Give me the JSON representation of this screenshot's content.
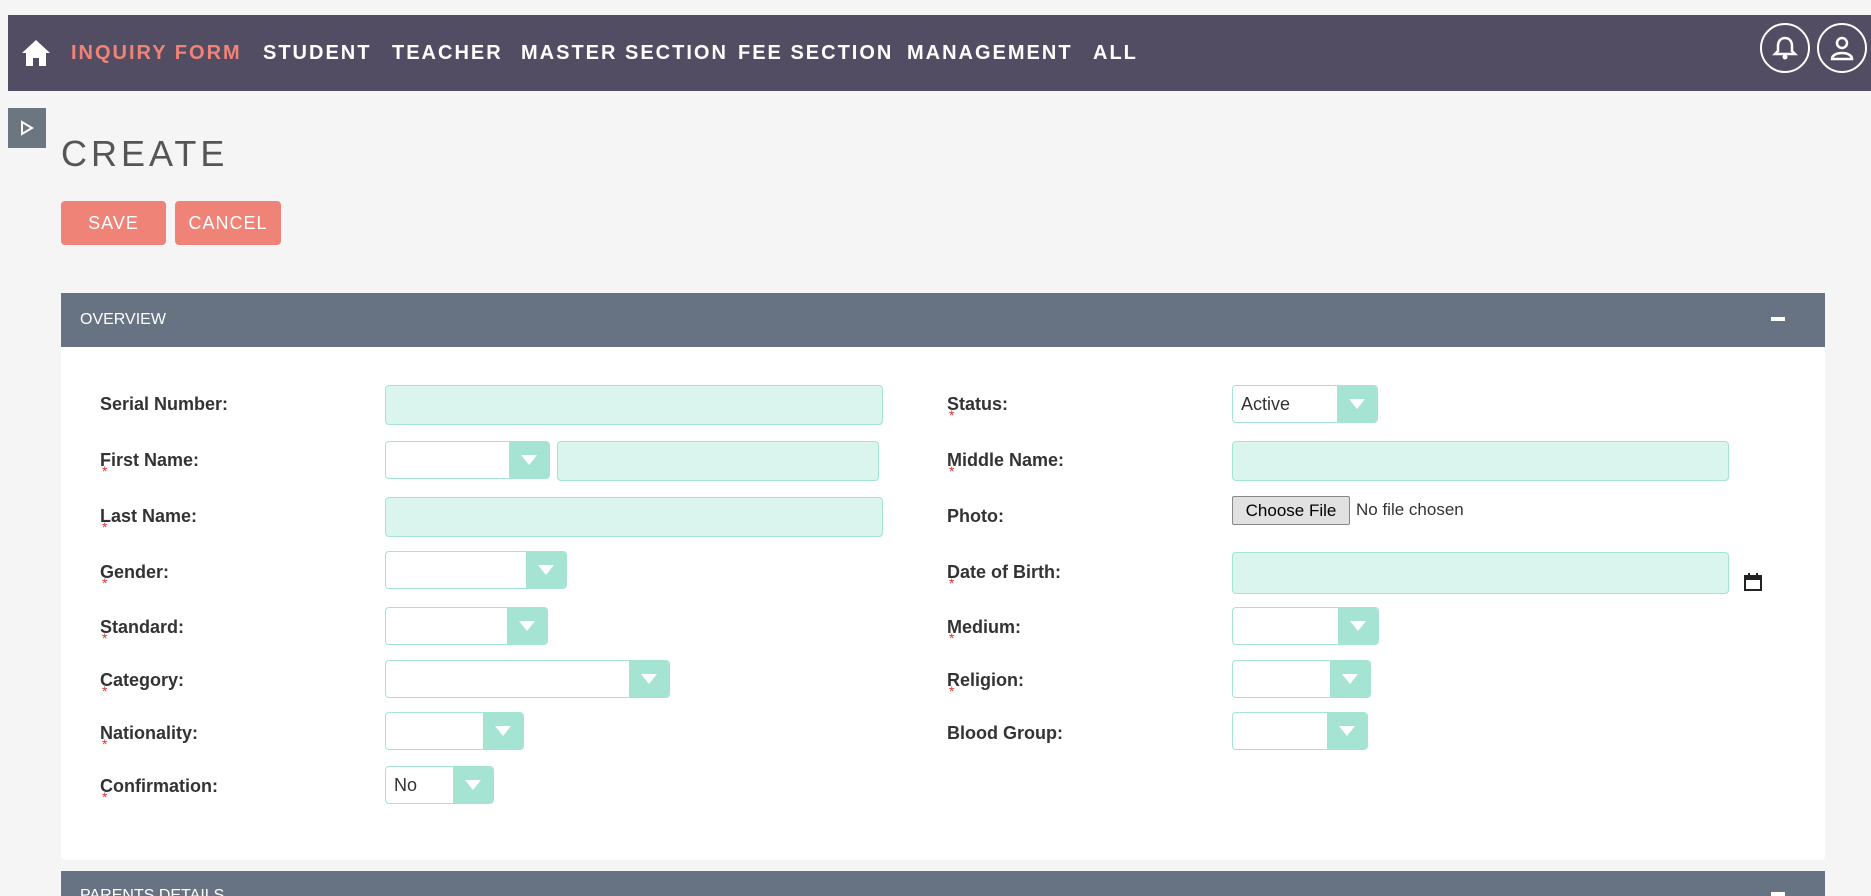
{
  "nav": {
    "items": [
      {
        "label": "INQUIRY FORM",
        "active": true
      },
      {
        "label": "STUDENT"
      },
      {
        "label": "TEACHER"
      },
      {
        "label": "MASTER SECTION"
      },
      {
        "label": "FEE SECTION"
      },
      {
        "label": "MANAGEMENT"
      },
      {
        "label": "ALL"
      }
    ],
    "icons": [
      "home-icon",
      "notification-bell-icon",
      "user-profile-icon"
    ]
  },
  "page": {
    "title": "CREATE",
    "save_label": "SAVE",
    "cancel_label": "CANCEL"
  },
  "overview": {
    "title": "OVERVIEW",
    "fields": {
      "serial_number": {
        "label": "Serial Number:",
        "value": ""
      },
      "first_name": {
        "label": "First Name:",
        "required": true,
        "salutation": "",
        "value": ""
      },
      "last_name": {
        "label": "Last Name:",
        "required": true,
        "value": ""
      },
      "gender": {
        "label": "Gender:",
        "required": true,
        "value": ""
      },
      "standard": {
        "label": "Standard:",
        "required": true,
        "value": ""
      },
      "category": {
        "label": "Category:",
        "required": true,
        "value": ""
      },
      "nationality": {
        "label": "Nationality:",
        "required": true,
        "value": ""
      },
      "confirmation": {
        "label": "Confirmation:",
        "required": true,
        "value": "No"
      },
      "status": {
        "label": "Status:",
        "required": true,
        "value": "Active"
      },
      "middle_name": {
        "label": "Middle Name:",
        "required": true,
        "value": ""
      },
      "photo": {
        "label": "Photo:",
        "button": "Choose File",
        "status": "No file chosen"
      },
      "date_of_birth": {
        "label": "Date of Birth:",
        "required": true,
        "value": ""
      },
      "medium": {
        "label": "Medium:",
        "required": true,
        "value": ""
      },
      "religion": {
        "label": "Religion:",
        "required": true,
        "value": ""
      },
      "blood_group": {
        "label": "Blood Group:",
        "value": ""
      }
    }
  },
  "parents": {
    "title": "PARENTS DETAILS"
  },
  "colors": {
    "navbar": "#534d64",
    "accent": "#f08377",
    "panel_header": "#677382",
    "input_bg": "#d9f5ee",
    "input_border": "#a5e3d3",
    "required": "#dd3333"
  }
}
